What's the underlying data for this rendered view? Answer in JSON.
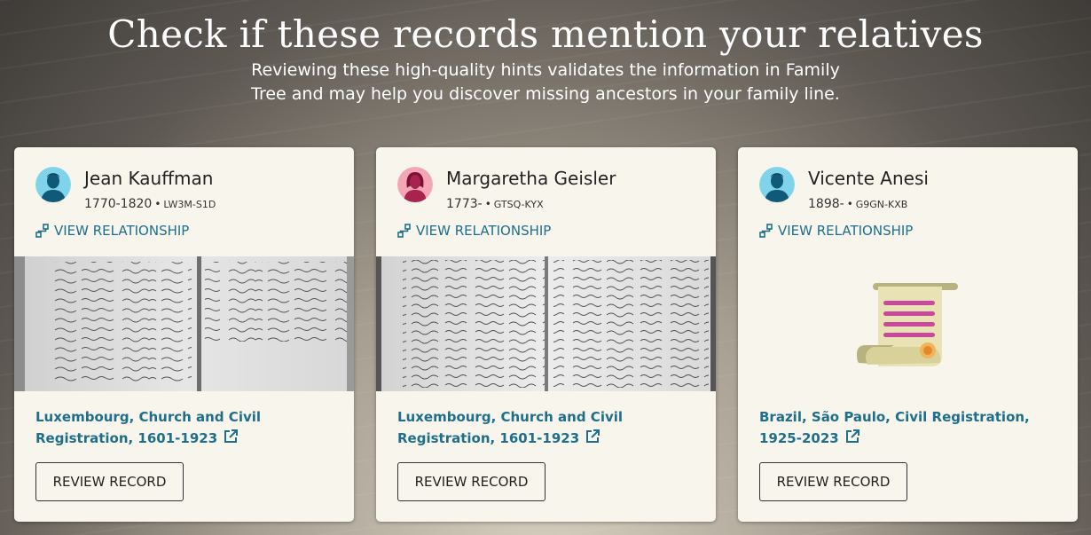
{
  "hero": {
    "title": "Check if these records mention your relatives",
    "subtitle_line1": "Reviewing these high-quality hints validates the information in Family",
    "subtitle_line2": "Tree and may help you discover missing ancestors in your family line."
  },
  "cards": [
    {
      "name": "Jean Kauffman",
      "lifespan": "1770-1820",
      "pid": "LW3M-S1D",
      "avatar_icon": "male-avatar-icon",
      "relationship_label": "VIEW RELATIONSHIP",
      "collection": "Luxembourg, Church and Civil Registration, 1601-1923",
      "review_label": "REVIEW RECORD"
    },
    {
      "name": "Margaretha Geisler",
      "lifespan": "1773-",
      "pid": "GTSQ-KYX",
      "avatar_icon": "female-avatar-icon",
      "relationship_label": "VIEW RELATIONSHIP",
      "collection": "Luxembourg, Church and Civil Registration, 1601-1923",
      "review_label": "REVIEW RECORD"
    },
    {
      "name": "Vicente Anesi",
      "lifespan": "1898-",
      "pid": "G9GN-KXB",
      "avatar_icon": "male-avatar-icon",
      "relationship_label": "VIEW RELATIONSHIP",
      "collection": "Brazil, São Paulo, Civil Registration, 1925-2023",
      "review_label": "REVIEW RECORD"
    }
  ],
  "colors": {
    "link": "#1f6f8b",
    "card_bg": "#f7f5ec",
    "male_avatar_bg": "#7fd3ea",
    "female_avatar_bg": "#f4a6b4",
    "scroll_icon_text_lines": "#c9479d"
  }
}
